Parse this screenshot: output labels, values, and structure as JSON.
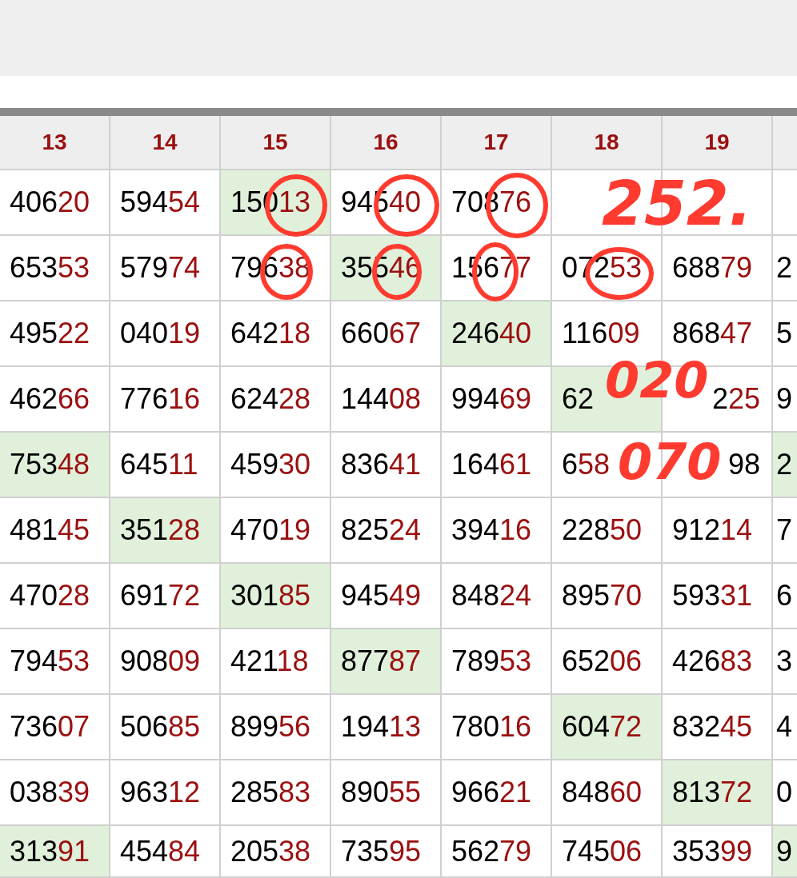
{
  "table": {
    "columns": [
      "13",
      "14",
      "15",
      "16",
      "17",
      "18",
      "19"
    ],
    "rows": [
      [
        {
          "value": "40620",
          "highlighted": false
        },
        {
          "value": "59454",
          "highlighted": false
        },
        {
          "value": "15013",
          "highlighted": true
        },
        {
          "value": "94540",
          "highlighted": false
        },
        {
          "value": "70876",
          "highlighted": false
        },
        {
          "highlighted": false
        },
        {
          "highlighted": false
        },
        {
          "highlighted": false
        }
      ],
      [
        {
          "value": "65353",
          "highlighted": false
        },
        {
          "value": "57974",
          "highlighted": false
        },
        {
          "value": "79638",
          "highlighted": false
        },
        {
          "value": "35546",
          "highlighted": true
        },
        {
          "value": "15677",
          "highlighted": false
        },
        {
          "value": "07253",
          "highlighted": false
        },
        {
          "value": "68879",
          "highlighted": false
        },
        {
          "value": "2",
          "highlighted": false
        }
      ],
      [
        {
          "value": "49522",
          "highlighted": false
        },
        {
          "value": "04019",
          "highlighted": false
        },
        {
          "value": "64218",
          "highlighted": false
        },
        {
          "value": "66067",
          "highlighted": false
        },
        {
          "value": "24640",
          "highlighted": true
        },
        {
          "value": "11609",
          "highlighted": false
        },
        {
          "value": "86847",
          "highlighted": false
        },
        {
          "value": "5",
          "highlighted": false
        }
      ],
      [
        {
          "value": "46266",
          "highlighted": false
        },
        {
          "value": "77616",
          "highlighted": false
        },
        {
          "value": "62428",
          "highlighted": false
        },
        {
          "value": "14408",
          "highlighted": false
        },
        {
          "value": "99469",
          "highlighted": false
        },
        {
          "value": "62",
          "highlighted": true
        },
        {
          "value": "225",
          "highlighted": false,
          "kind": "tail"
        },
        {
          "value": "9",
          "highlighted": false
        }
      ],
      [
        {
          "value": "75348",
          "highlighted": true
        },
        {
          "value": "64511",
          "highlighted": false
        },
        {
          "value": "45930",
          "highlighted": false
        },
        {
          "value": "83641",
          "highlighted": false
        },
        {
          "value": "16461",
          "highlighted": false
        },
        {
          "value": "658",
          "highlighted": false
        },
        {
          "value": "98",
          "highlighted": false,
          "kind": "tail"
        },
        {
          "value": "2",
          "highlighted": true
        }
      ],
      [
        {
          "value": "48145",
          "highlighted": false
        },
        {
          "value": "35128",
          "highlighted": true
        },
        {
          "value": "47019",
          "highlighted": false
        },
        {
          "value": "82524",
          "highlighted": false
        },
        {
          "value": "39416",
          "highlighted": false
        },
        {
          "value": "22850",
          "highlighted": false
        },
        {
          "value": "91214",
          "highlighted": false
        },
        {
          "value": "7",
          "highlighted": false
        }
      ],
      [
        {
          "value": "47028",
          "highlighted": false
        },
        {
          "value": "69172",
          "highlighted": false
        },
        {
          "value": "30185",
          "highlighted": true
        },
        {
          "value": "94549",
          "highlighted": false
        },
        {
          "value": "84824",
          "highlighted": false
        },
        {
          "value": "89570",
          "highlighted": false
        },
        {
          "value": "59331",
          "highlighted": false
        },
        {
          "value": "6",
          "highlighted": false
        }
      ],
      [
        {
          "value": "79453",
          "highlighted": false
        },
        {
          "value": "90809",
          "highlighted": false
        },
        {
          "value": "42118",
          "highlighted": false
        },
        {
          "value": "87787",
          "highlighted": true
        },
        {
          "value": "78953",
          "highlighted": false
        },
        {
          "value": "65206",
          "highlighted": false
        },
        {
          "value": "42683",
          "highlighted": false
        },
        {
          "value": "3",
          "highlighted": false
        }
      ],
      [
        {
          "value": "73607",
          "highlighted": false
        },
        {
          "value": "50685",
          "highlighted": false
        },
        {
          "value": "89956",
          "highlighted": false
        },
        {
          "value": "19413",
          "highlighted": false
        },
        {
          "value": "78016",
          "highlighted": false
        },
        {
          "value": "60472",
          "highlighted": true
        },
        {
          "value": "83245",
          "highlighted": false
        },
        {
          "value": "4",
          "highlighted": false
        }
      ],
      [
        {
          "value": "03839",
          "highlighted": false
        },
        {
          "value": "96312",
          "highlighted": false
        },
        {
          "value": "28583",
          "highlighted": false
        },
        {
          "value": "89055",
          "highlighted": false
        },
        {
          "value": "96621",
          "highlighted": false
        },
        {
          "value": "84860",
          "highlighted": false
        },
        {
          "value": "81372",
          "highlighted": true
        },
        {
          "value": "0",
          "highlighted": false
        }
      ],
      [
        {
          "value": "31391",
          "highlighted": true
        },
        {
          "value": "45484",
          "highlighted": false
        },
        {
          "value": "20538",
          "highlighted": false
        },
        {
          "value": "73595",
          "highlighted": false
        },
        {
          "value": "56279",
          "highlighted": false
        },
        {
          "value": "74506",
          "highlighted": false
        },
        {
          "value": "35399",
          "highlighted": false
        },
        {
          "value": "9",
          "highlighted": true
        }
      ]
    ]
  },
  "annotations": {
    "notes": [
      "252.",
      "020",
      "070"
    ]
  }
}
